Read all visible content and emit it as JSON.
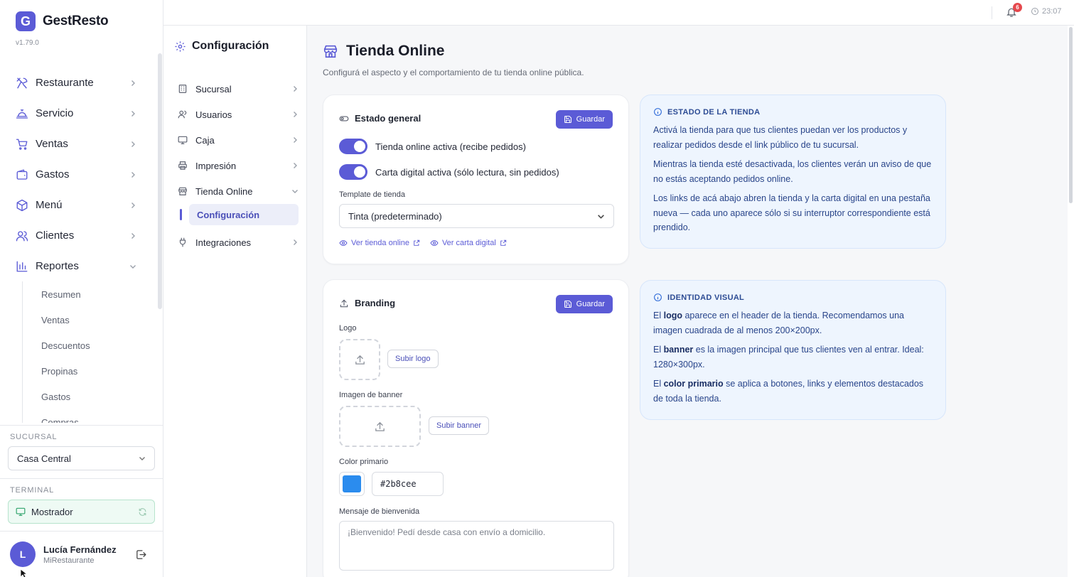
{
  "app": {
    "name": "GestResto",
    "logo_letter": "G",
    "version": "v1.79.0"
  },
  "sidebar": {
    "items": [
      {
        "label": "Restaurante",
        "icon": "utensils-icon"
      },
      {
        "label": "Servicio",
        "icon": "cloche-icon"
      },
      {
        "label": "Ventas",
        "icon": "cart-icon"
      },
      {
        "label": "Gastos",
        "icon": "wallet-icon"
      },
      {
        "label": "Menú",
        "icon": "box-icon"
      },
      {
        "label": "Clientes",
        "icon": "users-icon"
      },
      {
        "label": "Reportes",
        "icon": "bar-chart-icon"
      }
    ],
    "reportes_sub": [
      "Resumen",
      "Ventas",
      "Descuentos",
      "Propinas",
      "Gastos",
      "Compras"
    ],
    "sucursal_label": "SUCURSAL",
    "sucursal_value": "Casa Central",
    "terminal_label": "TERMINAL",
    "terminal_value": "Mostrador",
    "user": {
      "initial": "L",
      "name": "Lucía Fernández",
      "org": "MiRestaurante"
    }
  },
  "topbar": {
    "notifications": "6",
    "time": "23:07"
  },
  "config_nav": {
    "title": "Configuración",
    "items": [
      {
        "label": "Sucursal",
        "icon": "building-icon"
      },
      {
        "label": "Usuarios",
        "icon": "users-icon"
      },
      {
        "label": "Caja",
        "icon": "monitor-icon"
      },
      {
        "label": "Impresión",
        "icon": "printer-icon"
      },
      {
        "label": "Tienda Online",
        "icon": "store-icon"
      },
      {
        "label": "Integraciones",
        "icon": "plug-icon"
      }
    ],
    "active_sub": "Configuración"
  },
  "page": {
    "title": "Tienda Online",
    "subtitle": "Configurá el aspecto y el comportamiento de tu tienda online pública."
  },
  "estado": {
    "title": "Estado general",
    "save_label": "Guardar",
    "toggle_tienda": "Tienda online activa (recibe pedidos)",
    "toggle_carta": "Carta digital activa (sólo lectura, sin pedidos)",
    "template_label": "Template de tienda",
    "template_value": "Tinta (predeterminado)",
    "link_tienda": "Ver tienda online",
    "link_carta": "Ver carta digital"
  },
  "branding": {
    "title": "Branding",
    "save_label": "Guardar",
    "logo_label": "Logo",
    "logo_button": "Subir logo",
    "banner_label": "Imagen de banner",
    "banner_button": "Subir banner",
    "color_label": "Color primario",
    "color_value": "#2b8cee",
    "welcome_label": "Mensaje de bienvenida",
    "welcome_value": "¡Bienvenido! Pedí desde casa con envío a domicilio."
  },
  "info_estado": {
    "title": "ESTADO DE LA TIENDA",
    "p1": "Activá la tienda para que tus clientes puedan ver los productos y realizar pedidos desde el link público de tu sucursal.",
    "p2": "Mientras la tienda esté desactivada, los clientes verán un aviso de que no estás aceptando pedidos online.",
    "p3": "Los links de acá abajo abren la tienda y la carta digital en una pestaña nueva — cada uno aparece sólo si su interruptor correspondiente está prendido."
  },
  "info_identidad": {
    "title": "IDENTIDAD VISUAL",
    "p1_pre": "El ",
    "p1_bold": "logo",
    "p1_post": " aparece en el header de la tienda. Recomendamos una imagen cuadrada de al menos 200×200px.",
    "p2_pre": "El ",
    "p2_bold": "banner",
    "p2_post": " es la imagen principal que tus clientes ven al entrar. Ideal: 1280×300px.",
    "p3_pre": "El ",
    "p3_bold": "color primario",
    "p3_post": " se aplica a botones, links y elementos destacados de toda la tienda."
  }
}
